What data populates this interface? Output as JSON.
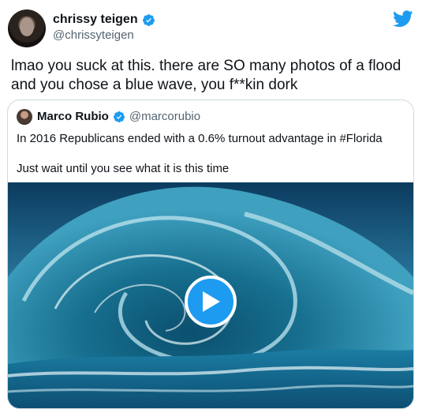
{
  "author": {
    "name": "chrissy teigen",
    "handle": "@chrissyteigen",
    "verified": true,
    "avatar_icon": "user-avatar"
  },
  "tweet_text": "lmao you suck at this. there are SO many photos of a flood and you chose a blue wave, you f**kin dork",
  "quoted": {
    "name": "Marco Rubio",
    "handle": "@marcorubio",
    "verified": true,
    "line1": "In 2016 Republicans ended with a 0.6% turnout advantage in #Florida",
    "line2": "Just wait until you see what it is this time",
    "media": {
      "type": "video",
      "subject": "ocean-wave",
      "play_icon": "play-icon"
    }
  },
  "brand": {
    "icon": "twitter-bird-icon",
    "color": "#1d9bf0"
  },
  "colors": {
    "text": "#0f1419",
    "secondary": "#536471",
    "border": "#cfd9de",
    "accent": "#1d9bf0"
  }
}
